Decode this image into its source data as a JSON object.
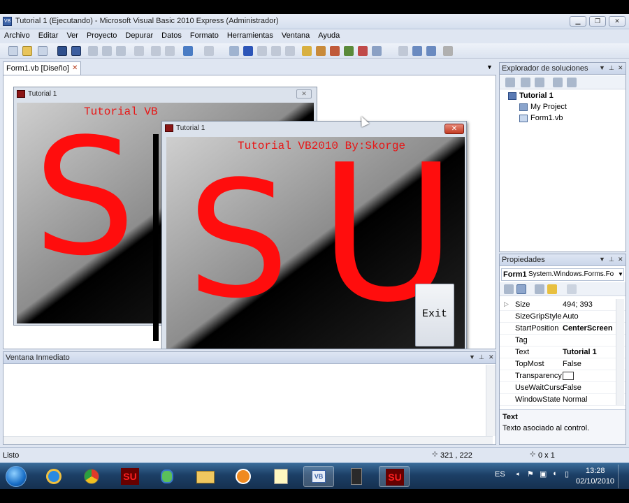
{
  "window": {
    "title": "Tutorial 1 (Ejecutando) - Microsoft Visual Basic 2010 Express (Administrador)",
    "min_icon": "minimize-icon",
    "max_icon": "maximize-icon",
    "close_icon": "close-icon"
  },
  "menu": [
    "Archivo",
    "Editar",
    "Ver",
    "Proyecto",
    "Depurar",
    "Datos",
    "Formato",
    "Herramientas",
    "Ventana",
    "Ayuda"
  ],
  "document_tab": {
    "label": "Form1.vb [Diseño]",
    "close": "✕"
  },
  "designer_form": {
    "title": "Tutorial 1",
    "caption_text": "Tutorial VB",
    "big_letter": "S"
  },
  "running_form": {
    "title": "Tutorial 1",
    "caption_text": "Tutorial VB2010 By:Skorge",
    "letter_s": "S",
    "letter_u": "U",
    "exit_label": "Exit"
  },
  "immediate": {
    "title": "Ventana Inmediato"
  },
  "solution_explorer": {
    "title": "Explorador de soluciones",
    "items": [
      {
        "label": "Tutorial 1",
        "bold": true
      },
      {
        "label": "My Project"
      },
      {
        "label": "Form1.vb"
      }
    ]
  },
  "properties": {
    "title": "Propiedades",
    "object": "Form1",
    "object_type": "System.Windows.Forms.Fo",
    "rows": [
      {
        "name": "Size",
        "value": "494; 393",
        "expand": "▷"
      },
      {
        "name": "SizeGripStyle",
        "value": "Auto"
      },
      {
        "name": "StartPosition",
        "value": "CenterScreen",
        "bold": true
      },
      {
        "name": "Tag",
        "value": ""
      },
      {
        "name": "Text",
        "value": "Tutorial 1",
        "bold": true
      },
      {
        "name": "TopMost",
        "value": "False"
      },
      {
        "name": "Transparency",
        "value": ""
      },
      {
        "name": "UseWaitCursc",
        "value": "False"
      },
      {
        "name": "WindowState",
        "value": "Normal"
      }
    ],
    "desc_title": "Text",
    "desc_text": "Texto asociado al control."
  },
  "status": {
    "left": "Listo",
    "position": "321 , 222",
    "size": "0 x 1"
  },
  "taskbar": {
    "lang": "ES",
    "time": "13:28",
    "date": "02/10/2010",
    "apps": [
      "start-orb-icon",
      "ie-icon",
      "chrome-icon",
      "su-app-icon",
      "messenger-icon",
      "folder-icon",
      "media-player-icon",
      "notepad-icon",
      "visual-basic-icon",
      "camera-icon",
      "su-running-icon"
    ]
  }
}
